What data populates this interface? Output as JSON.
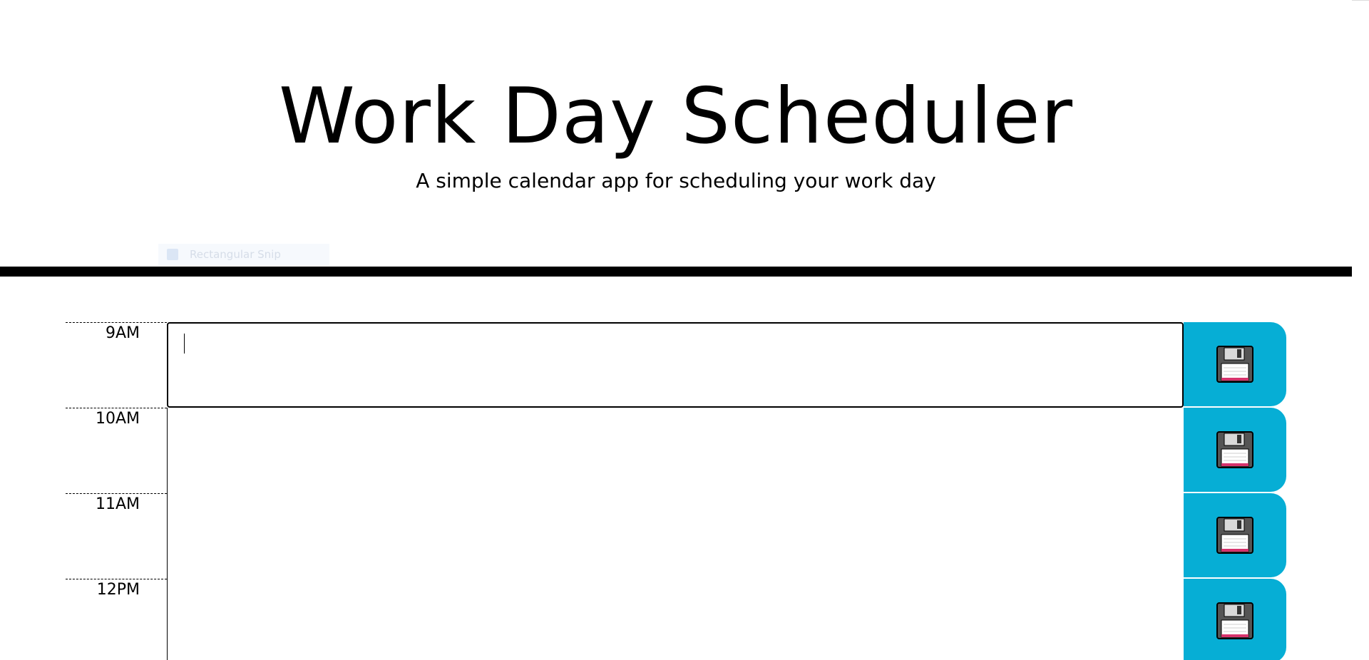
{
  "header": {
    "title": "Work Day Scheduler",
    "subtitle": "A simple calendar app for scheduling your work day"
  },
  "overlay": {
    "ghost_label": "Rectangular Snip"
  },
  "schedule": {
    "rows": [
      {
        "hour": "9AM",
        "text": "",
        "save_icon": "floppy-disk-icon"
      },
      {
        "hour": "10AM",
        "text": "",
        "save_icon": "floppy-disk-icon"
      },
      {
        "hour": "11AM",
        "text": "",
        "save_icon": "floppy-disk-icon"
      },
      {
        "hour": "12PM",
        "text": "",
        "save_icon": "floppy-disk-icon"
      }
    ]
  },
  "colors": {
    "save_button": "#06aed5",
    "header_border": "#000000"
  }
}
